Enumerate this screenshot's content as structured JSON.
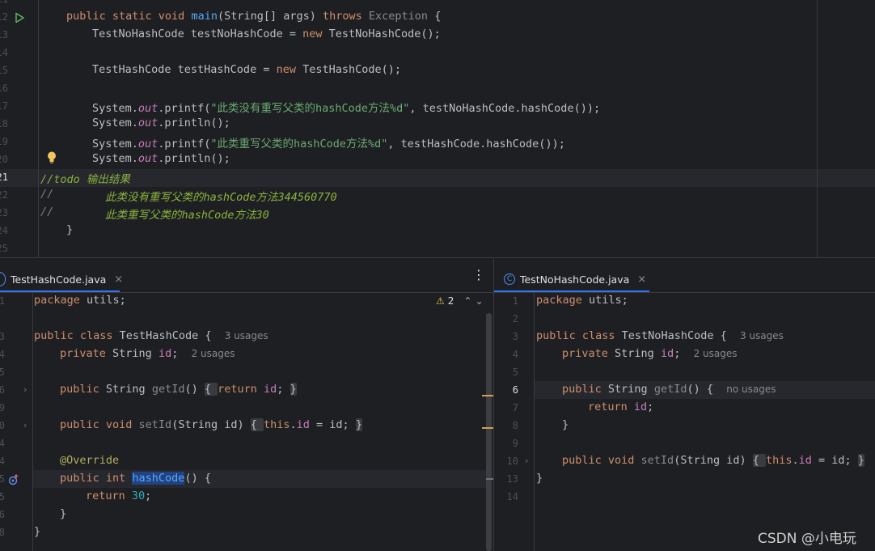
{
  "top_editor": {
    "line_numbers": [
      "11",
      "12",
      "13",
      "14",
      "15",
      "16",
      "17",
      "18",
      "19",
      "20",
      "21",
      "22",
      "23",
      "24",
      "25"
    ],
    "lines": {
      "l12": {
        "kw1": "public static void ",
        "fn": "main",
        "p1": "(String[] args) ",
        "kw2": "throws ",
        "gray": "Exception",
        "p2": " {"
      },
      "l13": {
        "p1": "TestNoHashCode testNoHashCode = ",
        "kw": "new ",
        "p2": "TestNoHashCode();"
      },
      "l15": {
        "p1": "TestHashCode testHashCode = ",
        "kw": "new ",
        "p2": "TestHashCode();"
      },
      "l17": {
        "p1": "System.",
        "fld": "out",
        "p2": ".printf(",
        "str": "\"此类没有重写父类的hashCode方法%d\"",
        "p3": ", testNoHashCode.hashCode());"
      },
      "l18": {
        "p1": "System.",
        "fld": "out",
        "p2": ".println();"
      },
      "l19": {
        "p1": "System.",
        "fld": "out",
        "p2": ".printf(",
        "str": "\"此类重写父类的hashCode方法%d\"",
        "p3": ", testHashCode.hashCode());"
      },
      "l20": {
        "p1": "System.",
        "fld": "out",
        "p2": ".println();"
      },
      "l21": {
        "c1": "//",
        "todo": "todo 输出结果"
      },
      "l22": {
        "c1": "//",
        "todo": "此类没有重写父类的hashCode方法344560770"
      },
      "l23": {
        "c1": "//",
        "todo": "此类重写父类的hashCode方法30"
      },
      "l24": {
        "p1": "}"
      }
    }
  },
  "left_editor": {
    "tab": {
      "name": "TestHashCode.java",
      "close": "×"
    },
    "more": "⋮",
    "warnings": {
      "icon": "⚠",
      "count": "2",
      "up": "⌃",
      "down": "⌄"
    },
    "line_numbers": [
      "1",
      "2",
      "3",
      "4",
      "5",
      "6",
      "9",
      "10",
      "14",
      "15",
      "16",
      "17",
      "18"
    ],
    "lines": {
      "l1": {
        "kw": "package ",
        "p": "utils;"
      },
      "l3": {
        "kw": "public class ",
        "p": "TestHashCode { ",
        "hint": "3 usages"
      },
      "l4": {
        "kw": "private ",
        "p": "String ",
        "prop": "id",
        "p2": "; ",
        "hint": "2 usages"
      },
      "l6": {
        "kw": "public ",
        "p": "String ",
        "gray": "getId",
        "p2": "() ",
        "f1": "{ ",
        "kw2": "return ",
        "prop": "id",
        "p3": "; ",
        "f2": "}"
      },
      "l10": {
        "kw": "public void ",
        "gray": "setId",
        "p": "(String id) ",
        "f1": "{ ",
        "kw2": "this",
        "p2": ".",
        "prop": "id",
        "p3": " = id; ",
        "f2": "}"
      },
      "l15": {
        "ann": "@Override"
      },
      "l16": {
        "kw": "public int ",
        "fn": "hashCode",
        "p": "() {"
      },
      "l17": {
        "kw": "return ",
        "num": "30",
        "p": ";"
      },
      "l18": {
        "p": "}"
      },
      "l19": {
        "p": "}"
      }
    }
  },
  "right_editor": {
    "tab": {
      "icon": "C",
      "name": "TestNoHashCode.java",
      "close": "×"
    },
    "line_numbers": [
      "1",
      "2",
      "3",
      "4",
      "5",
      "6",
      "7",
      "8",
      "9",
      "10",
      "13",
      "14"
    ],
    "lines": {
      "l1": {
        "kw": "package ",
        "p": "utils;"
      },
      "l3": {
        "kw": "public class ",
        "p": "TestNoHashCode { ",
        "hint": "3 usages"
      },
      "l4": {
        "kw": "private ",
        "p": "String ",
        "prop": "id",
        "p2": "; ",
        "hint": "2 usages"
      },
      "l6": {
        "kw": "public ",
        "p": "String ",
        "gray": "getId",
        "p2": "() { ",
        "hint": "no usages"
      },
      "l7": {
        "kw": "return ",
        "prop": "id",
        "p": ";"
      },
      "l8": {
        "p": "}"
      },
      "l10": {
        "kw": "public void ",
        "gray": "setId",
        "p": "(String id) ",
        "f1": "{ ",
        "kw2": "this",
        "p2": ".",
        "prop": "id",
        "p3": " = id; ",
        "f2": "}"
      },
      "l13": {
        "p": "}"
      }
    }
  },
  "watermark": "CSDN @小电玩",
  "colors": {
    "background": "#1e1f22",
    "keyword": "#cf8e6d",
    "string": "#6aab73",
    "function": "#56a8f5",
    "field": "#c77dbb",
    "todo": "#8bb33d",
    "accent": "#3574f0"
  }
}
